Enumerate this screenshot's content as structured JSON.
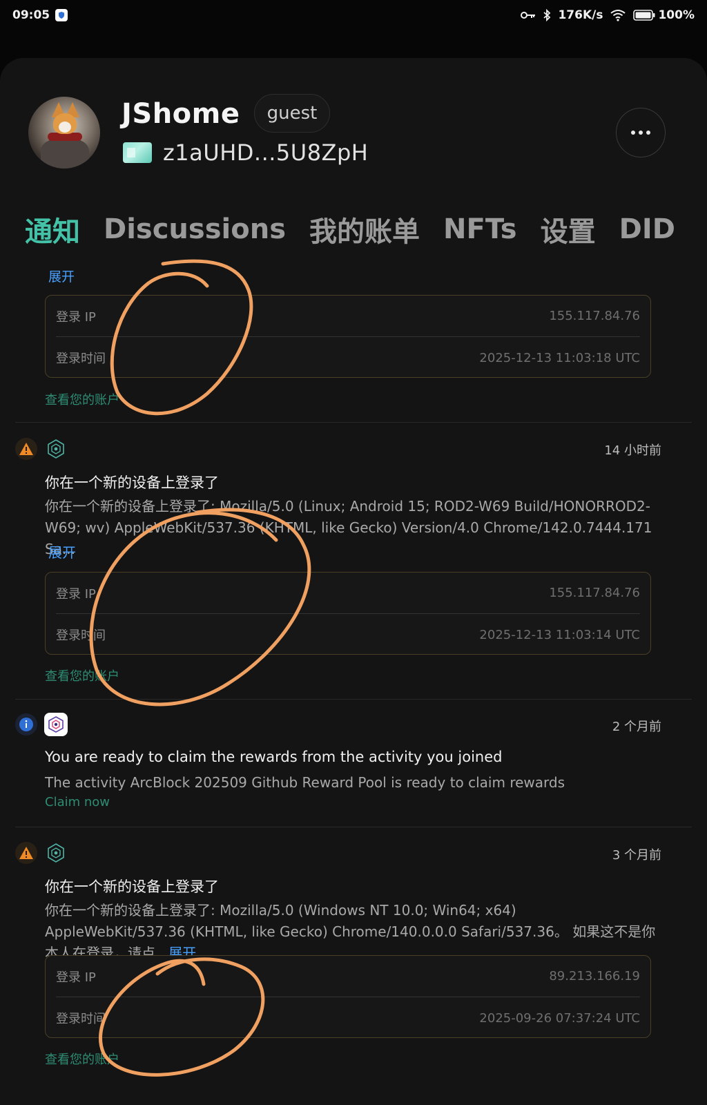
{
  "status_bar": {
    "time": "09:05",
    "network_speed": "176K/s",
    "battery": "100%",
    "icons": [
      "shield-icon",
      "key-icon",
      "bluetooth-icon",
      "wifi-icon",
      "battery-icon"
    ]
  },
  "profile": {
    "name": "JShome",
    "role": "guest",
    "did": "z1aUHD...5U8ZpH"
  },
  "tabs": [
    {
      "label": "通知",
      "active": true
    },
    {
      "label": "Discussions",
      "active": false
    },
    {
      "label": "我的账单",
      "active": false
    },
    {
      "label": "NFTs",
      "active": false
    },
    {
      "label": "设置",
      "active": false
    },
    {
      "label": "DID Spa",
      "active": false
    }
  ],
  "notifications": {
    "top_partial": {
      "expand": "展开",
      "ip_label": "登录 IP",
      "ip_value": "155.117.84.76",
      "time_label": "登录时间",
      "time_value": "2025-12-13 11:03:18 UTC",
      "view_account": "查看您的账户"
    },
    "login_1": {
      "time_ago": "14 小时前",
      "title": "你在一个新的设备上登录了",
      "body": "你在一个新的设备上登录了: Mozilla/5.0 (Linux; Android 15; ROD2-W69 Build/HONORROD2-W69; wv) AppleWebKit/537.36 (KHTML, like Gecko) Version/4.0 Chrome/142.0.7444.171 Sa...",
      "expand": "展开",
      "ip_label": "登录 IP",
      "ip_value": "155.117.84.76",
      "time_label": "登录时间",
      "time_value": "2025-12-13 11:03:14 UTC",
      "view_account": "查看您的账户"
    },
    "reward": {
      "time_ago": "2 个月前",
      "title": "You are ready to claim the rewards from the activity you joined",
      "body": "The activity ArcBlock 202509 Github Reward Pool is ready to claim rewards",
      "claim": "Claim now"
    },
    "login_2": {
      "time_ago": "3 个月前",
      "title": "你在一个新的设备上登录了",
      "body": "你在一个新的设备上登录了: Mozilla/5.0 (Windows NT 10.0; Win64; x64) AppleWebKit/537.36 (KHTML, like Gecko) Chrome/140.0.0.0 Safari/537.36。 如果这不是你本人在登录，请点...",
      "expand": "展开",
      "ip_label": "登录 IP",
      "ip_value": "89.213.166.19",
      "time_label": "登录时间",
      "time_value": "2025-09-26 07:37:24 UTC",
      "view_account": "查看您的账户"
    }
  },
  "colors": {
    "accent": "#44c2a7",
    "link": "#47a0ff",
    "warning": "#f08a24",
    "info": "#2f6fd6",
    "scribble": "#f0a060"
  }
}
